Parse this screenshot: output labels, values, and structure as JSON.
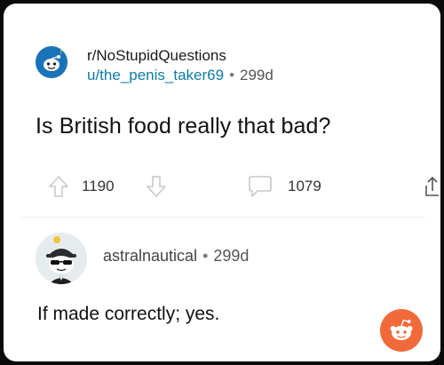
{
  "post": {
    "subreddit": "r/NoStupidQuestions",
    "author": "u/the_penis_taker69",
    "separator": "•",
    "age": "299d",
    "title": "Is British food really that bad?",
    "upvotes": "1190",
    "comments": "1079"
  },
  "comment": {
    "author": "astralnautical",
    "separator": "•",
    "age": "299d",
    "body": "If made correctly; yes."
  },
  "icons": {
    "subreddit_avatar": "reddit-mascot-icon",
    "upvote": "arrow-up-icon",
    "downvote": "arrow-down-icon",
    "comments": "speech-bubble-icon",
    "share": "share-icon",
    "commenter_avatar": "snoo-sunglasses-avatar-icon",
    "app_badge": "reddit-logo-icon"
  },
  "colors": {
    "author_link": "#0f7ca5",
    "reddit_orange": "#f16a3a",
    "subreddit_avatar_bg": "#1a73b8"
  }
}
